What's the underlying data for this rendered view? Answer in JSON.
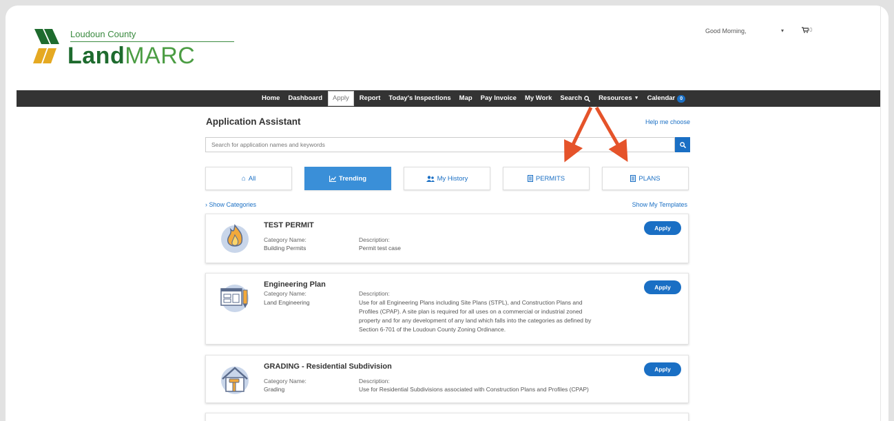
{
  "header": {
    "logo_county": "Loudoun County",
    "logo_land": "Land",
    "logo_marc": "MARC",
    "greeting": "Good Morning,",
    "user_dropdown": "▾",
    "cart_count": "0"
  },
  "nav": {
    "items": [
      {
        "label": "Home"
      },
      {
        "label": "Dashboard"
      },
      {
        "label": "Apply"
      },
      {
        "label": "Report"
      },
      {
        "label": "Today's Inspections"
      },
      {
        "label": "Map"
      },
      {
        "label": "Pay Invoice"
      },
      {
        "label": "My Work"
      },
      {
        "label": "Search"
      },
      {
        "label": "Resources"
      },
      {
        "label": "Calendar"
      }
    ],
    "calendar_badge": "0"
  },
  "page": {
    "title": "Application Assistant",
    "help_link": "Help me choose",
    "search_placeholder": "Search for application names and keywords",
    "show_categories": "› Show Categories",
    "show_templates": "Show My Templates"
  },
  "tabs": [
    {
      "label": "All",
      "icon": "home-icon"
    },
    {
      "label": "Trending",
      "icon": "chart-icon"
    },
    {
      "label": "My History",
      "icon": "users-icon"
    },
    {
      "label": "PERMITS",
      "icon": "document-icon"
    },
    {
      "label": "PLANS",
      "icon": "document-icon"
    }
  ],
  "colors": {
    "nav_bg": "#333333",
    "accent": "#1a6fc4",
    "active_tab": "#3a8fd8",
    "annotation_arrow": "#e5532a",
    "logo_green": "#1e6b2e"
  },
  "cards": [
    {
      "name": "TEST PERMIT",
      "category_label": "Category Name:",
      "category": "Building Permits",
      "description_label": "Description:",
      "description": [
        "Permit test case"
      ],
      "apply": "Apply",
      "icon": "fire-icon"
    },
    {
      "name": "Engineering Plan",
      "category_label": "Category Name:",
      "category": "Land Engineering",
      "description_label": "Description:",
      "description": [
        "Use for all Engineering Plans including Site Plans (STPL), and Construction Plans and",
        "Profiles (CPAP). A site plan is required for all uses on a commercial or industrial zoned",
        "property and for any development of any land which falls into the categories as defined by",
        "Section 6-701 of the Loudoun County Zoning Ordinance."
      ],
      "apply": "Apply",
      "icon": "blueprint-icon"
    },
    {
      "name": "GRADING - Residential Subdivision",
      "category_label": "Category Name:",
      "category": "Grading",
      "description_label": "Description:",
      "description": [
        "Use for Residential Subdivisions associated with Construction Plans and Profiles (CPAP)"
      ],
      "apply": "Apply",
      "icon": "house-hammer-icon"
    }
  ]
}
